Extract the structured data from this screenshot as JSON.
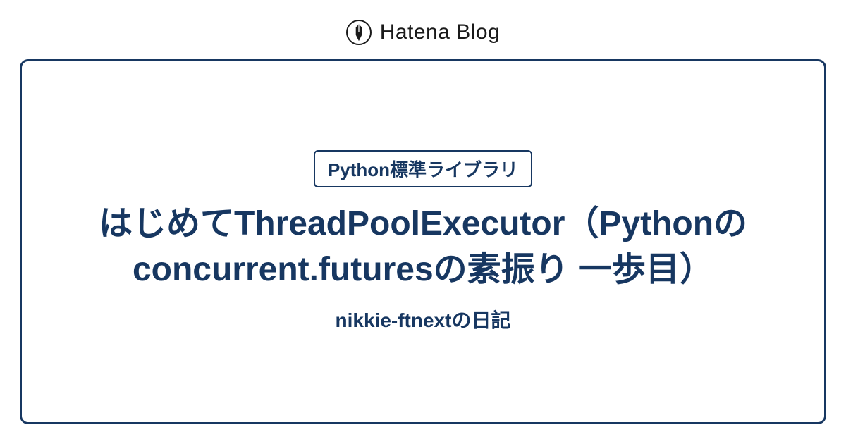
{
  "header": {
    "brand": "Hatena Blog"
  },
  "card": {
    "category": "Python標準ライブラリ",
    "title": "はじめてThreadPoolExecutor（Pythonのconcurrent.futuresの素振り 一歩目）",
    "blog_name": "nikkie-ftnextの日記"
  },
  "colors": {
    "primary": "#173761",
    "text": "#1a1a1a",
    "background": "#ffffff"
  }
}
